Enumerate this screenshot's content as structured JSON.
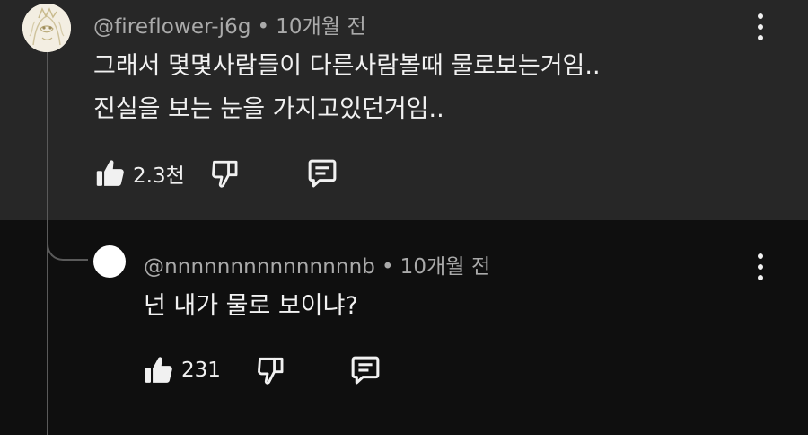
{
  "comment": {
    "username": "@fireflower-j6g",
    "separator": "•",
    "time": "10개월 전",
    "lines": [
      "그래서 몇몇사람들이 다른사람볼때 물로보는거임..",
      "진실을 보는 눈을 가지고있던거임.."
    ],
    "like_count": "2.3천",
    "icons": {
      "like": "thumbs-up-icon",
      "dislike": "thumbs-down-icon",
      "reply": "reply-comment-icon",
      "more": "more-vert-icon"
    }
  },
  "reply": {
    "username": "@nnnnnnnnnnnnnnnb",
    "separator": "•",
    "time": "10개월 전",
    "text": "넌 내가 물로 보이냐?",
    "like_count": "231",
    "icons": {
      "like": "thumbs-up-icon",
      "dislike": "thumbs-down-icon",
      "reply": "reply-comment-icon",
      "more": "more-vert-icon"
    }
  },
  "colors": {
    "comment_background": "#272727",
    "page_background": "#0f0f0f",
    "primary_text": "#f1f1f1",
    "secondary_text": "#aaaaaa"
  }
}
